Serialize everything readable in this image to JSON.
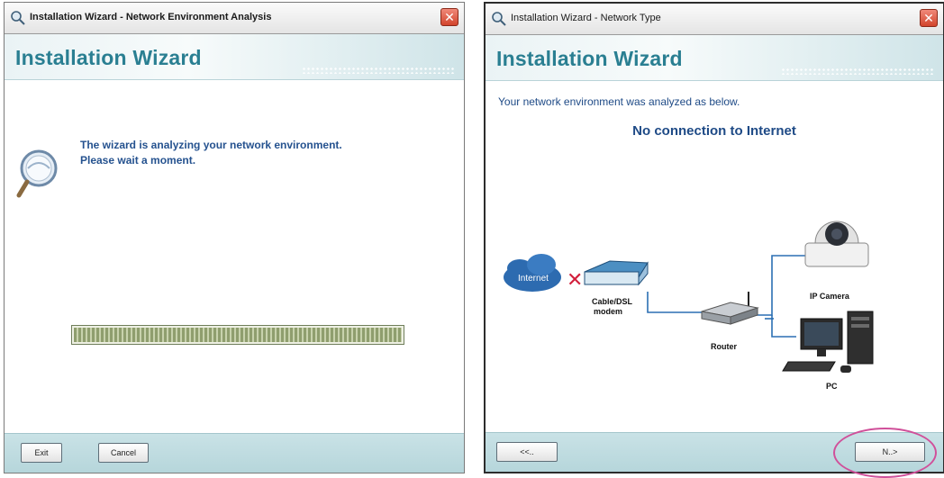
{
  "left_window": {
    "title": "Installation Wizard - Network Environment Analysis",
    "banner_title": "Installation Wizard",
    "message_line1": "The wizard is analyzing your network environment.",
    "message_line2": "Please wait a moment.",
    "progress": 1.0,
    "exit_label": "Exit",
    "cancel_label": "Cancel",
    "close_glyph": "✕"
  },
  "right_window": {
    "title": "Installation Wizard - Network Type",
    "banner_title": "Installation Wizard",
    "analysis_line": "Your network environment was analyzed as below.",
    "status_line": "No connection to Internet",
    "back_label": "<<..",
    "next_label": "N..>",
    "close_glyph": "✕",
    "diagram": {
      "internet_label": "Internet",
      "modem_label_1": "Cable/DSL",
      "modem_label_2": "modem",
      "router_label": "Router",
      "camera_label": "IP Camera",
      "pc_label": "PC",
      "cross_glyph": "✕"
    }
  },
  "colors": {
    "title_blue": "#2a7f92",
    "text_blue": "#25528f",
    "footer_teal": "#b6d6db",
    "highlight_pink": "#d0509a",
    "disconnect_red": "#d21f3c"
  },
  "icons": [
    "magnifier-icon",
    "close-icon",
    "cloud-icon",
    "camera-icon",
    "router-icon",
    "pc-icon",
    "modem-icon"
  ]
}
